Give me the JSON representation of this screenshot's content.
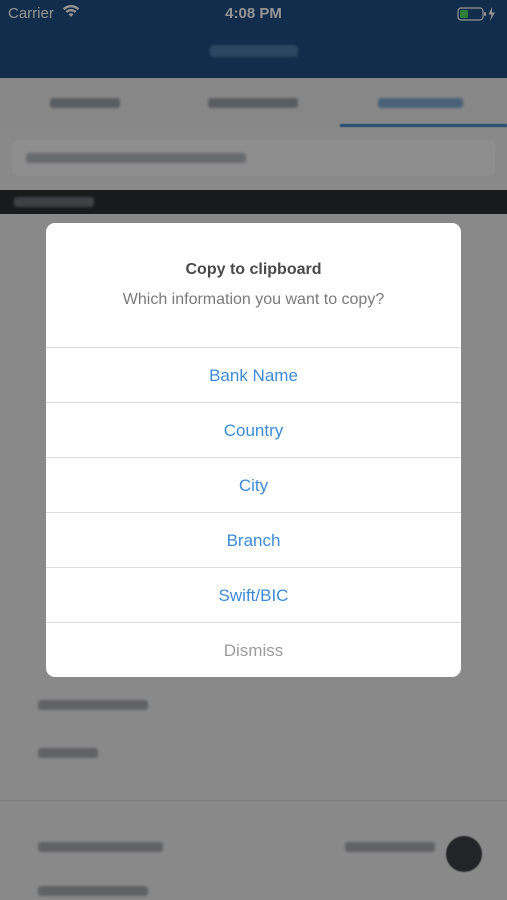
{
  "status_bar": {
    "carrier": "Carrier",
    "time": "4:08 PM",
    "icons": [
      "wifi-icon",
      "battery-icon",
      "charging-bolt-icon"
    ],
    "bar_color": "#1f4f82"
  },
  "dialog": {
    "title": "Copy to clipboard",
    "message": "Which information you want to copy?",
    "actions": [
      {
        "label": "Bank Name"
      },
      {
        "label": "Country"
      },
      {
        "label": "City"
      },
      {
        "label": "Branch"
      },
      {
        "label": "Swift/BIC"
      },
      {
        "label": "Dismiss"
      }
    ],
    "action_color": "#3d8bd6",
    "dismiss_color": "#9b9b9b"
  }
}
